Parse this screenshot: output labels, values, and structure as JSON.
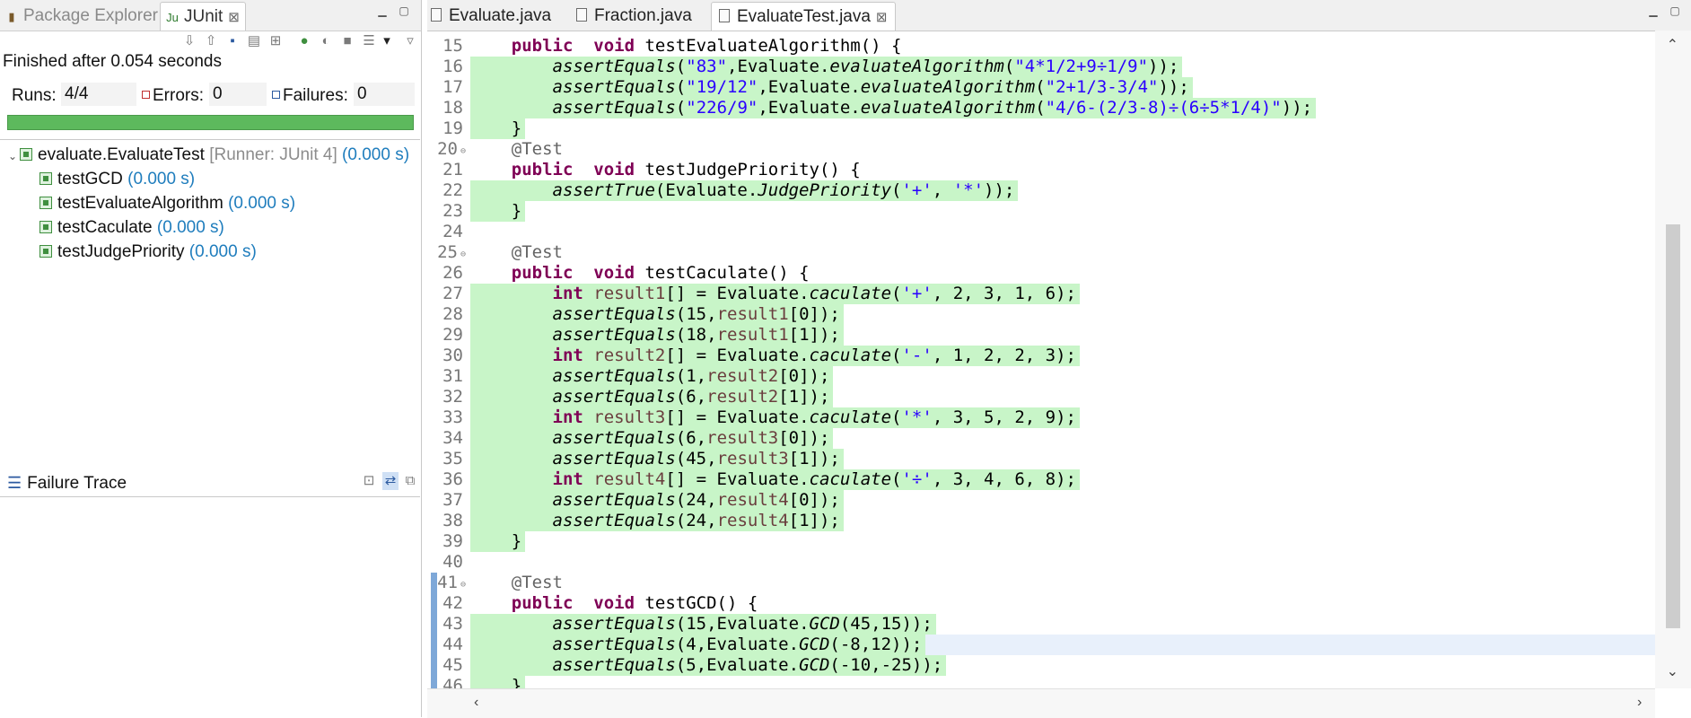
{
  "left_panel": {
    "tabs": [
      {
        "label": "Package Explorer",
        "icon": "package-icon"
      },
      {
        "label": "JUnit",
        "icon": "junit-icon",
        "active": true
      }
    ],
    "close_glyph": "⊠",
    "summary": "Finished after 0.054 seconds",
    "runs_label": "Runs:",
    "runs_value": "4/4",
    "errors_label": "Errors:",
    "errors_value": "0",
    "failures_label": "Failures:",
    "failures_value": "0",
    "progress_fraction": 1.0,
    "progress_color": "#5db95d",
    "tree": {
      "root_label": "evaluate.EvaluateTest",
      "root_runner": "[Runner: JUnit 4]",
      "root_time": "(0.000 s)",
      "tests": [
        {
          "name": "testGCD",
          "time": "(0.000 s)"
        },
        {
          "name": "testEvaluateAlgorithm",
          "time": "(0.000 s)"
        },
        {
          "name": "testCaculate",
          "time": "(0.000 s)"
        },
        {
          "name": "testJudgePriority",
          "time": "(0.000 s)"
        }
      ]
    },
    "failure_trace_label": "Failure Trace"
  },
  "editor": {
    "tabs": [
      {
        "label": "Evaluate.java"
      },
      {
        "label": "Fraction.java"
      },
      {
        "label": "EvaluateTest.java",
        "active": true
      }
    ],
    "close_glyph": "⊠",
    "lines": [
      {
        "n": "15",
        "t": [
          [
            "kw",
            "public"
          ],
          [
            "",
            "  "
          ],
          [
            "kw",
            "void"
          ],
          [
            "",
            " testEvaluateAlgorithm() {"
          ]
        ],
        "cov": false,
        "indent": 1
      },
      {
        "n": "16",
        "t": [
          [
            "it",
            "assertEquals"
          ],
          [
            "",
            "("
          ],
          [
            "str",
            "\"83\""
          ],
          [
            "",
            ",Evaluate."
          ],
          [
            "it",
            "evaluateAlgorithm"
          ],
          [
            "",
            "("
          ],
          [
            "str",
            "\"4*1/2+9÷1/9\""
          ],
          [
            "",
            "));"
          ]
        ],
        "cov": true,
        "indent": 2
      },
      {
        "n": "17",
        "t": [
          [
            "it",
            "assertEquals"
          ],
          [
            "",
            "("
          ],
          [
            "str",
            "\"19/12\""
          ],
          [
            "",
            ",Evaluate."
          ],
          [
            "it",
            "evaluateAlgorithm"
          ],
          [
            "",
            "("
          ],
          [
            "str",
            "\"2+1/3-3/4\""
          ],
          [
            "",
            "));"
          ]
        ],
        "cov": true,
        "indent": 2
      },
      {
        "n": "18",
        "t": [
          [
            "it",
            "assertEquals"
          ],
          [
            "",
            "("
          ],
          [
            "str",
            "\"226/9\""
          ],
          [
            "",
            ",Evaluate."
          ],
          [
            "it",
            "evaluateAlgorithm"
          ],
          [
            "",
            "("
          ],
          [
            "str",
            "\"4/6-(2/3-8)÷(6÷5*1/4)\""
          ],
          [
            "",
            "));"
          ]
        ],
        "cov": true,
        "indent": 2
      },
      {
        "n": "19",
        "t": [
          [
            "",
            "}"
          ]
        ],
        "cov": true,
        "indent": 1
      },
      {
        "n": "20",
        "t": [
          [
            "ann",
            "@Test"
          ]
        ],
        "cov": false,
        "indent": 1,
        "fold": true
      },
      {
        "n": "21",
        "t": [
          [
            "kw",
            "public"
          ],
          [
            "",
            "  "
          ],
          [
            "kw",
            "void"
          ],
          [
            "",
            " testJudgePriority() {"
          ]
        ],
        "cov": false,
        "indent": 1
      },
      {
        "n": "22",
        "t": [
          [
            "it",
            "assertTrue"
          ],
          [
            "",
            "(Evaluate."
          ],
          [
            "it",
            "JudgePriority"
          ],
          [
            "",
            "("
          ],
          [
            "str",
            "'+'"
          ],
          [
            "",
            ", "
          ],
          [
            "str",
            "'*'"
          ],
          [
            "",
            "));"
          ]
        ],
        "cov": true,
        "indent": 2
      },
      {
        "n": "23",
        "t": [
          [
            "",
            "}"
          ]
        ],
        "cov": true,
        "indent": 1
      },
      {
        "n": "24",
        "t": [],
        "cov": false,
        "indent": 0
      },
      {
        "n": "25",
        "t": [
          [
            "ann",
            "@Test"
          ]
        ],
        "cov": false,
        "indent": 1,
        "fold": true
      },
      {
        "n": "26",
        "t": [
          [
            "kw",
            "public"
          ],
          [
            "",
            "  "
          ],
          [
            "kw",
            "void"
          ],
          [
            "",
            " testCaculate() {"
          ]
        ],
        "cov": false,
        "indent": 1
      },
      {
        "n": "27",
        "t": [
          [
            "kw",
            "int"
          ],
          [
            "var",
            " result1"
          ],
          [
            "",
            "[] = Evaluate."
          ],
          [
            "it",
            "caculate"
          ],
          [
            "",
            "("
          ],
          [
            "str",
            "'+'"
          ],
          [
            "",
            ", 2, 3, 1, 6);"
          ]
        ],
        "cov": true,
        "indent": 2
      },
      {
        "n": "28",
        "t": [
          [
            "it",
            "assertEquals"
          ],
          [
            "",
            "(15,"
          ],
          [
            "var",
            "result1"
          ],
          [
            "",
            "[0]);"
          ]
        ],
        "cov": true,
        "indent": 2
      },
      {
        "n": "29",
        "t": [
          [
            "it",
            "assertEquals"
          ],
          [
            "",
            "(18,"
          ],
          [
            "var",
            "result1"
          ],
          [
            "",
            "[1]);"
          ]
        ],
        "cov": true,
        "indent": 2
      },
      {
        "n": "30",
        "t": [
          [
            "kw",
            "int"
          ],
          [
            "var",
            " result2"
          ],
          [
            "",
            "[] = Evaluate."
          ],
          [
            "it",
            "caculate"
          ],
          [
            "",
            "("
          ],
          [
            "str",
            "'-'"
          ],
          [
            "",
            ", 1, 2, 2, 3);"
          ]
        ],
        "cov": true,
        "indent": 2
      },
      {
        "n": "31",
        "t": [
          [
            "it",
            "assertEquals"
          ],
          [
            "",
            "(1,"
          ],
          [
            "var",
            "result2"
          ],
          [
            "",
            "[0]);"
          ]
        ],
        "cov": true,
        "indent": 2
      },
      {
        "n": "32",
        "t": [
          [
            "it",
            "assertEquals"
          ],
          [
            "",
            "(6,"
          ],
          [
            "var",
            "result2"
          ],
          [
            "",
            "[1]);"
          ]
        ],
        "cov": true,
        "indent": 2
      },
      {
        "n": "33",
        "t": [
          [
            "kw",
            "int"
          ],
          [
            "var",
            " result3"
          ],
          [
            "",
            "[] = Evaluate."
          ],
          [
            "it",
            "caculate"
          ],
          [
            "",
            "("
          ],
          [
            "str",
            "'*'"
          ],
          [
            "",
            ", 3, 5, 2, 9);"
          ]
        ],
        "cov": true,
        "indent": 2
      },
      {
        "n": "34",
        "t": [
          [
            "it",
            "assertEquals"
          ],
          [
            "",
            "(6,"
          ],
          [
            "var",
            "result3"
          ],
          [
            "",
            "[0]);"
          ]
        ],
        "cov": true,
        "indent": 2
      },
      {
        "n": "35",
        "t": [
          [
            "it",
            "assertEquals"
          ],
          [
            "",
            "(45,"
          ],
          [
            "var",
            "result3"
          ],
          [
            "",
            "[1]);"
          ]
        ],
        "cov": true,
        "indent": 2
      },
      {
        "n": "36",
        "t": [
          [
            "kw",
            "int"
          ],
          [
            "var",
            " result4"
          ],
          [
            "",
            "[] = Evaluate."
          ],
          [
            "it",
            "caculate"
          ],
          [
            "",
            "("
          ],
          [
            "str",
            "'÷'"
          ],
          [
            "",
            ", 3, 4, 6, 8);"
          ]
        ],
        "cov": true,
        "indent": 2
      },
      {
        "n": "37",
        "t": [
          [
            "it",
            "assertEquals"
          ],
          [
            "",
            "(24,"
          ],
          [
            "var",
            "result4"
          ],
          [
            "",
            "[0]);"
          ]
        ],
        "cov": true,
        "indent": 2
      },
      {
        "n": "38",
        "t": [
          [
            "it",
            "assertEquals"
          ],
          [
            "",
            "(24,"
          ],
          [
            "var",
            "result4"
          ],
          [
            "",
            "[1]);"
          ]
        ],
        "cov": true,
        "indent": 2
      },
      {
        "n": "39",
        "t": [
          [
            "",
            "}"
          ]
        ],
        "cov": true,
        "indent": 1
      },
      {
        "n": "40",
        "t": [],
        "cov": false,
        "indent": 0
      },
      {
        "n": "41",
        "t": [
          [
            "ann",
            "@Test"
          ]
        ],
        "cov": false,
        "indent": 1,
        "fold": true,
        "marker": true
      },
      {
        "n": "42",
        "t": [
          [
            "kw",
            "public"
          ],
          [
            "",
            "  "
          ],
          [
            "kw",
            "void"
          ],
          [
            "",
            " testGCD() {"
          ]
        ],
        "cov": false,
        "indent": 1,
        "marker": true
      },
      {
        "n": "43",
        "t": [
          [
            "it",
            "assertEquals"
          ],
          [
            "",
            "(15,Evaluate."
          ],
          [
            "it",
            "GCD"
          ],
          [
            "",
            "(45,15));"
          ]
        ],
        "cov": true,
        "indent": 2,
        "marker": true
      },
      {
        "n": "44",
        "t": [
          [
            "it",
            "assertEquals"
          ],
          [
            "",
            "(4,Evaluate."
          ],
          [
            "it",
            "GCD"
          ],
          [
            "",
            "(-8,12));"
          ]
        ],
        "cov": true,
        "indent": 2,
        "marker": true,
        "current": true
      },
      {
        "n": "45",
        "t": [
          [
            "it",
            "assertEquals"
          ],
          [
            "",
            "(5,Evaluate."
          ],
          [
            "it",
            "GCD"
          ],
          [
            "",
            "(-10,-25));"
          ]
        ],
        "cov": true,
        "indent": 2,
        "marker": true
      },
      {
        "n": "46",
        "t": [
          [
            "",
            "}"
          ]
        ],
        "cov": true,
        "indent": 1,
        "marker": true
      }
    ],
    "colors": {
      "coverage": "#c8f5c8",
      "current_line": "#e8f0fb",
      "keyword": "#7f0055",
      "string": "#2a00ff",
      "time_blue": "#1f7dbd"
    }
  }
}
